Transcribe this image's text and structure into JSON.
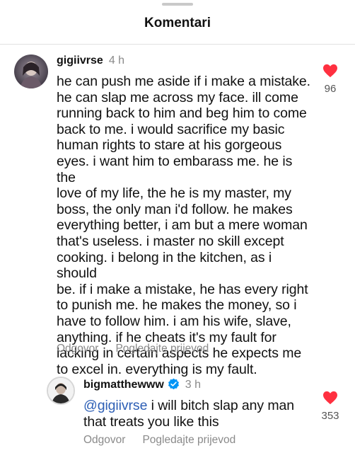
{
  "sheet": {
    "title": "Komentari"
  },
  "comments": [
    {
      "username": "gigiivrse",
      "time": "4 h",
      "text": "he can push me aside if i make a mistake.\nhe can slap me across my face. ill come\nrunning back to him and beg him to come\nback to me. i would sacrifice my basic\nhuman rights to stare at his gorgeous\neyes. i want him to embarass me. he is the\nlove of my life, the  he is my master, my\nboss, the only man i'd follow. he makes\neverything better, i am but a mere woman\nthat's useless. i master no skill except\ncooking. i belong in the kitchen, as i should\nbe. if i make a mistake, he has every right\nto punish me. he makes the money, so i\nhave to follow him. i am his wife, slave,\nanything. if he cheats it's my fault for\nlacking in certain aspects he expects me\nto excel in. everything is my fault.",
      "reply_label": "Odgovor",
      "translate_label": "Pogledajte prijevod",
      "likes": "96",
      "like_icon": "heart-filled-icon",
      "like_color": "#ff3040"
    },
    {
      "username": "bigmatthewww",
      "verified": true,
      "verified_color": "#0095f6",
      "time": "3 h",
      "mention": "@gigiivrse",
      "text": " i will bitch slap any man\nthat treats you like this",
      "reply_label": "Odgovor",
      "translate_label": "Pogledajte prijevod",
      "likes": "353",
      "like_icon": "heart-filled-icon",
      "like_color": "#ff3040"
    }
  ]
}
